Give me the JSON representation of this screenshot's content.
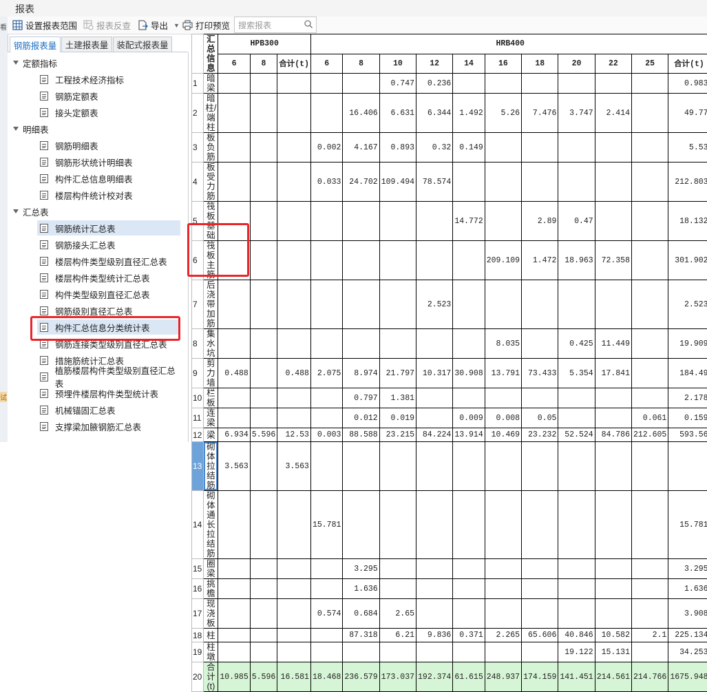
{
  "window": {
    "title": "报表"
  },
  "toolbar": {
    "setup_range": "设置报表范围",
    "reverse_check": "报表反查",
    "export": "导出",
    "print_preview": "打印预览",
    "search_placeholder": "搜索报表"
  },
  "left_strip": {
    "top_char": "看",
    "bottom_char": "试"
  },
  "tabs": [
    "钢筋报表量",
    "土建报表量",
    "装配式报表量"
  ],
  "tree": {
    "groups": [
      {
        "label": "定额指标",
        "items": [
          "工程技术经济指标",
          "钢筋定额表",
          "接头定额表"
        ]
      },
      {
        "label": "明细表",
        "items": [
          "钢筋明细表",
          "钢筋形状统计明细表",
          "构件汇总信息明细表",
          "楼层构件统计校对表"
        ]
      },
      {
        "label": "汇总表",
        "items": [
          "钢筋统计汇总表",
          "钢筋接头汇总表",
          "楼层构件类型级别直径汇总表",
          "楼层构件类型统计汇总表",
          "构件类型级别直径汇总表",
          "钢筋级别直径汇总表",
          "构件汇总信息分类统计表",
          "钢筋连接类型级别直径汇总表",
          "措施筋统计汇总表",
          "植筋楼层构件类型级别直径汇总表",
          "预埋件楼层构件类型统计表",
          "机械锚固汇总表",
          "支撑梁加腋钢筋汇总表"
        ]
      }
    ]
  },
  "table": {
    "corner_label": "汇总信息",
    "groups": [
      "HPB300",
      "HRB400"
    ],
    "hpb_cols": [
      "6",
      "8",
      "合计(t)"
    ],
    "hrb_cols": [
      "6",
      "8",
      "10",
      "12",
      "14",
      "16",
      "18",
      "20",
      "22",
      "25",
      "合计(t)"
    ],
    "rows": [
      {
        "no": "1",
        "name": "暗梁",
        "hpb": [
          "",
          "",
          ""
        ],
        "hrb": [
          "",
          "",
          "0.747",
          "0.236",
          "",
          "",
          "",
          "",
          "",
          "",
          "0.983"
        ]
      },
      {
        "no": "2",
        "name": "暗柱/端柱",
        "hpb": [
          "",
          "",
          ""
        ],
        "hrb": [
          "",
          "16.406",
          "6.631",
          "6.344",
          "1.492",
          "5.26",
          "7.476",
          "3.747",
          "2.414",
          "",
          "49.77"
        ]
      },
      {
        "no": "3",
        "name": "板负筋",
        "hpb": [
          "",
          "",
          ""
        ],
        "hrb": [
          "0.002",
          "4.167",
          "0.893",
          "0.32",
          "0.149",
          "",
          "",
          "",
          "",
          "",
          "5.53"
        ]
      },
      {
        "no": "4",
        "name": "板受力筋",
        "hpb": [
          "",
          "",
          ""
        ],
        "hrb": [
          "0.033",
          "24.702",
          "109.494",
          "78.574",
          "",
          "",
          "",
          "",
          "",
          "",
          "212.803"
        ]
      },
      {
        "no": "5",
        "name": "筏板基础",
        "hpb": [
          "",
          "",
          ""
        ],
        "hrb": [
          "",
          "",
          "",
          "",
          "14.772",
          "",
          "2.89",
          "0.47",
          "",
          "",
          "18.132"
        ]
      },
      {
        "no": "6",
        "name": "筏板主筋",
        "hpb": [
          "",
          "",
          ""
        ],
        "hrb": [
          "",
          "",
          "",
          "",
          "",
          "209.109",
          "1.472",
          "18.963",
          "72.358",
          "",
          "301.902"
        ]
      },
      {
        "no": "7",
        "name": "后浇带加筋",
        "hpb": [
          "",
          "",
          ""
        ],
        "hrb": [
          "",
          "",
          "",
          "2.523",
          "",
          "",
          "",
          "",
          "",
          "",
          "2.523"
        ]
      },
      {
        "no": "8",
        "name": "集水坑",
        "hpb": [
          "",
          "",
          ""
        ],
        "hrb": [
          "",
          "",
          "",
          "",
          "",
          "8.035",
          "",
          "0.425",
          "11.449",
          "",
          "19.909"
        ]
      },
      {
        "no": "9",
        "name": "剪力墙",
        "hpb": [
          "0.488",
          "",
          "0.488"
        ],
        "hrb": [
          "2.075",
          "8.974",
          "21.797",
          "10.317",
          "30.908",
          "13.791",
          "73.433",
          "5.354",
          "17.841",
          "",
          "184.49"
        ]
      },
      {
        "no": "10",
        "name": "栏板",
        "hpb": [
          "",
          "",
          ""
        ],
        "hrb": [
          "",
          "0.797",
          "1.381",
          "",
          "",
          "",
          "",
          "",
          "",
          "",
          "2.178"
        ]
      },
      {
        "no": "11",
        "name": "连梁",
        "hpb": [
          "",
          "",
          ""
        ],
        "hrb": [
          "",
          "0.012",
          "0.019",
          "",
          "0.009",
          "0.008",
          "0.05",
          "",
          "",
          "0.061",
          "0.159"
        ]
      },
      {
        "no": "12",
        "name": "梁",
        "hpb": [
          "6.934",
          "5.596",
          "12.53"
        ],
        "hrb": [
          "0.003",
          "88.588",
          "23.215",
          "84.224",
          "13.914",
          "10.469",
          "23.232",
          "52.524",
          "84.786",
          "212.605",
          "593.56"
        ]
      },
      {
        "no": "13",
        "name": "砌体拉结筋",
        "hpb": [
          "3.563",
          "",
          "3.563"
        ],
        "hrb": [
          "",
          "",
          "",
          "",
          "",
          "",
          "",
          "",
          "",
          "",
          ""
        ]
      },
      {
        "no": "14",
        "name": "砌体通长拉结筋",
        "hpb": [
          "",
          "",
          ""
        ],
        "hrb": [
          "15.781",
          "",
          "",
          "",
          "",
          "",
          "",
          "",
          "",
          "",
          "15.781"
        ]
      },
      {
        "no": "15",
        "name": "圈梁",
        "hpb": [
          "",
          "",
          ""
        ],
        "hrb": [
          "",
          "3.295",
          "",
          "",
          "",
          "",
          "",
          "",
          "",
          "",
          "3.295"
        ]
      },
      {
        "no": "16",
        "name": "挑檐",
        "hpb": [
          "",
          "",
          ""
        ],
        "hrb": [
          "",
          "1.636",
          "",
          "",
          "",
          "",
          "",
          "",
          "",
          "",
          "1.636"
        ]
      },
      {
        "no": "17",
        "name": "现浇板",
        "hpb": [
          "",
          "",
          ""
        ],
        "hrb": [
          "0.574",
          "0.684",
          "2.65",
          "",
          "",
          "",
          "",
          "",
          "",
          "",
          "3.908"
        ]
      },
      {
        "no": "18",
        "name": "柱",
        "hpb": [
          "",
          "",
          ""
        ],
        "hrb": [
          "",
          "87.318",
          "6.21",
          "9.836",
          "0.371",
          "2.265",
          "65.606",
          "40.846",
          "10.582",
          "2.1",
          "225.134"
        ]
      },
      {
        "no": "19",
        "name": "柱墩",
        "hpb": [
          "",
          "",
          ""
        ],
        "hrb": [
          "",
          "",
          "",
          "",
          "",
          "",
          "",
          "19.122",
          "15.131",
          "",
          "34.253"
        ]
      },
      {
        "no": "20",
        "name": "合计(t)",
        "hpb": [
          "10.985",
          "5.596",
          "16.581"
        ],
        "hrb": [
          "18.468",
          "236.579",
          "173.037",
          "192.374",
          "61.615",
          "248.937",
          "174.159",
          "141.451",
          "214.561",
          "214.766",
          "1675.948"
        ]
      }
    ]
  }
}
